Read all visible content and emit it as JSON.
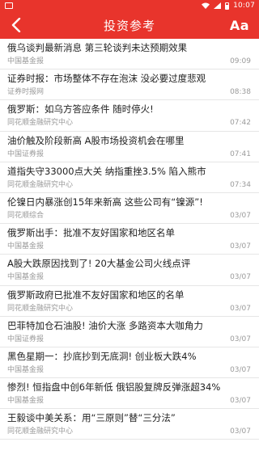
{
  "status_bar": {
    "time": "10:07",
    "icons": [
      "sim-card-icon",
      "wifi-icon",
      "signal-icon",
      "battery-icon"
    ]
  },
  "header": {
    "title": "投资参考",
    "back_icon": "chevron-left-icon",
    "font_button": "Aa",
    "background_color": "#e8342c"
  },
  "news": [
    {
      "title": "俄乌谈判最新消息 第三轮谈判未达预期效果",
      "source": "中国基金报",
      "time": "09:09"
    },
    {
      "title": "证券时报：市场整体不存在泡沫 没必要过度悲观",
      "source": "证券时报网",
      "time": "08:38"
    },
    {
      "title": "俄罗斯：如乌方答应条件 随时停火!",
      "source": "同花顺金融研究中心",
      "time": "07:42"
    },
    {
      "title": "油价触及阶段新高 A股市场投资机会在哪里",
      "source": "中国证券报",
      "time": "07:41"
    },
    {
      "title": "道指失守33000点大关 纳指重挫3.5% 陷入熊市",
      "source": "同花顺金融研究中心",
      "time": "07:34"
    },
    {
      "title": "伦镍日内暴涨创15年来新高 这些公司有“镍源”!",
      "source": "同花顺综合",
      "time": "03/07"
    },
    {
      "title": "俄罗斯出手：批准不友好国家和地区名单",
      "source": "中国基金报",
      "time": "03/07"
    },
    {
      "title": "A股大跌原因找到了! 20大基金公司火线点评",
      "source": "中国基金报",
      "time": "03/07"
    },
    {
      "title": "俄罗斯政府已批准不友好国家和地区的名单",
      "source": "同花顺金融研究中心",
      "time": "03/07"
    },
    {
      "title": "巴菲特加仓石油股! 油价大涨 多路资本大咖角力",
      "source": "中国证券报",
      "time": "03/07"
    },
    {
      "title": "黑色星期一：抄底抄到无底洞! 创业板大跌4%",
      "source": "中国基金报",
      "time": "03/07"
    },
    {
      "title": "惨烈! 恒指盘中创6年新低 俄铝股复牌反弹涨超34%",
      "source": "中国基金报",
      "time": "03/07"
    },
    {
      "title": "王毅谈中美关系：用“三原则”替“三分法”",
      "source": "同花顺金融研究中心",
      "time": "03/07"
    }
  ]
}
